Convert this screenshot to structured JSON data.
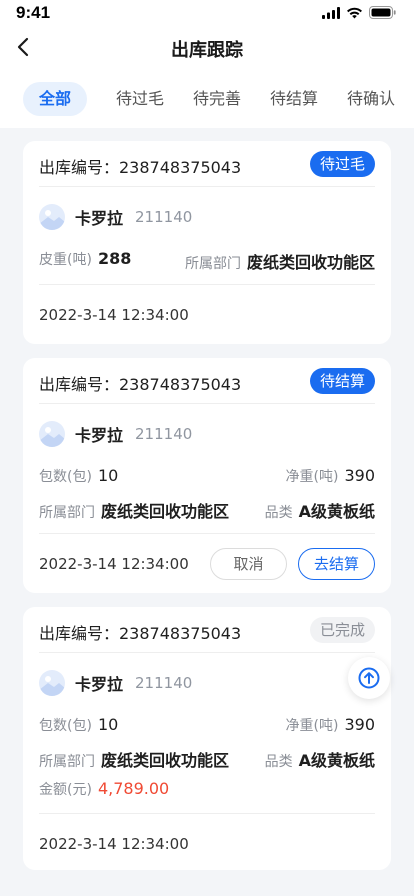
{
  "status_bar": {
    "time": "9:41"
  },
  "nav": {
    "title": "出库跟踪"
  },
  "tabs": [
    {
      "label": "全部",
      "active": true
    },
    {
      "label": "待过毛"
    },
    {
      "label": "待完善"
    },
    {
      "label": "待结算"
    },
    {
      "label": "待确认"
    }
  ],
  "cards": [
    {
      "order_label": "出库编号：238748375043",
      "status": "待过毛",
      "user": {
        "name": "卡罗拉",
        "id": "211140"
      },
      "tare_key": "皮重(吨)",
      "tare_value": "288",
      "dept_key": "所属部门",
      "dept_value": "废纸类回收功能区",
      "date": "2022-3-14  12:34:00"
    },
    {
      "order_label": "出库编号：238748375043",
      "status": "待结算",
      "user": {
        "name": "卡罗拉",
        "id": "211140"
      },
      "pkg_key": "包数(包)",
      "pkg_value": "10",
      "net_key": "净重(吨)",
      "net_value": "390",
      "dept_key": "所属部门",
      "dept_value": "废纸类回收功能区",
      "cat_key": "品类",
      "cat_value": "A级黄板纸",
      "date": "2022-3-14  12:34:00",
      "cancel_label": "取消",
      "settle_label": "去结算"
    },
    {
      "order_label": "出库编号：238748375043",
      "status": "已完成",
      "user": {
        "name": "卡罗拉",
        "id": "211140"
      },
      "pkg_key": "包数(包)",
      "pkg_value": "10",
      "net_key": "净重(吨)",
      "net_value": "390",
      "dept_key": "所属部门",
      "dept_value": "废纸类回收功能区",
      "cat_key": "品类",
      "cat_value": "A级黄板纸",
      "amount_key": "金额(元)",
      "amount_value": "4,789.00",
      "date": "2022-3-14  12:34:00"
    }
  ],
  "colors": {
    "accent": "#1a6cf0",
    "amount": "#f04a34",
    "background": "#f3f5f8"
  },
  "icons": [
    "back-chevron-icon",
    "signal-icon",
    "wifi-icon",
    "battery-icon",
    "avatar-landscape-icon",
    "scroll-top-arrow-icon"
  ]
}
